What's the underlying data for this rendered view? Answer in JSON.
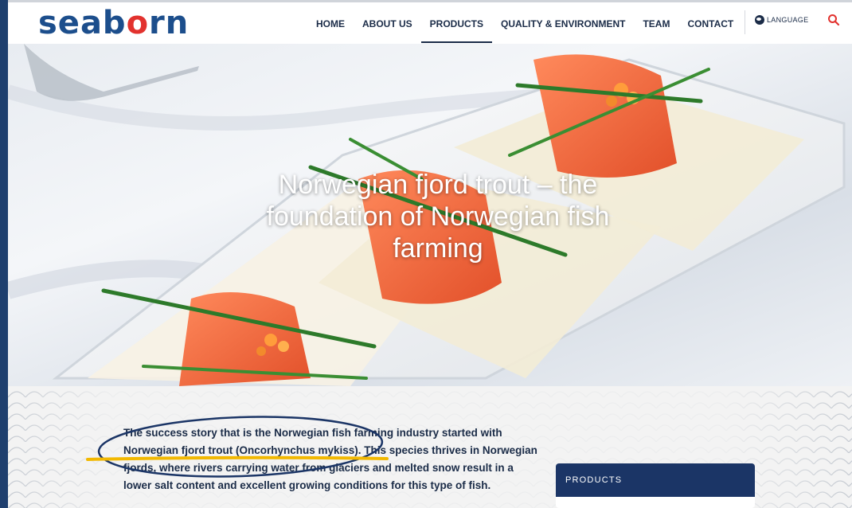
{
  "header": {
    "logo": {
      "text_left": "seab",
      "text_dot": "o",
      "text_right": "rn"
    },
    "nav": [
      {
        "label": "HOME",
        "active": false
      },
      {
        "label": "ABOUT US",
        "active": false
      },
      {
        "label": "PRODUCTS",
        "active": true
      },
      {
        "label": "QUALITY & ENVIRONMENT",
        "active": false
      },
      {
        "label": "TEAM",
        "active": false
      },
      {
        "label": "CONTACT",
        "active": false
      }
    ],
    "language_label": "LANGUAGE",
    "icons": {
      "globe": "globe-icon",
      "search": "search-icon"
    }
  },
  "hero": {
    "title": "Norwegian fjord trout – the foundation of Norwegian fish farming"
  },
  "main": {
    "intro": "The success story that is the Norwegian fish farming industry started with Norwegian fjord trout (Oncorhynchus mykiss). This species thrives in Norwegian fjords, where rivers carrying water from glaciers and melted snow result in a lower salt content and excellent growing conditions for this type of fish.",
    "sidebar_title": "PRODUCTS"
  },
  "colors": {
    "brand_blue": "#1c4e8c",
    "brand_red": "#e2322e",
    "nav_text": "#1b2c48",
    "annotation_blue": "#1b3566",
    "annotation_yellow": "#f2b800"
  }
}
